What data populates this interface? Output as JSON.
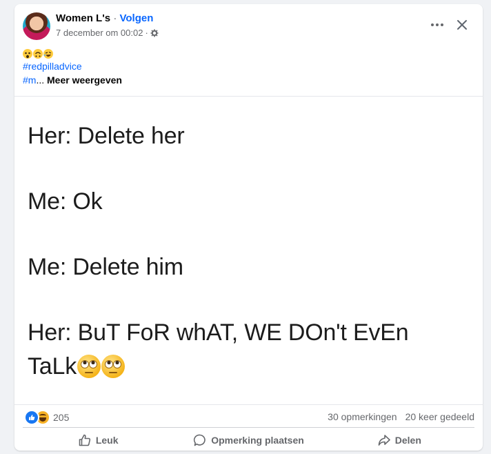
{
  "post": {
    "author": "Women L's",
    "separator": "·",
    "follow_label": "Volgen",
    "timestamp": "7 december om 00:02",
    "meta_separator": "·",
    "audience_icon": "gear-icon",
    "caption": {
      "emojis": [
        "astonished-emoji",
        "upside-down-emoji",
        "rofl-emoji"
      ],
      "hashtag_1": "#redpilladvice",
      "hashtag_2": "#m",
      "truncation": "...",
      "see_more": "Meer weergeven"
    },
    "image_text": {
      "line_1": "Her: Delete her",
      "line_2": "Me: Ok",
      "line_3": "Me: Delete him",
      "line_4": "Her: BuT FoR whAT, WE DOn't EvEn",
      "line_5": "TaLk"
    },
    "stats": {
      "reaction_count": "205",
      "comments": "30 opmerkingen",
      "shares": "20 keer gedeeld"
    },
    "actions": {
      "like": "Leuk",
      "comment": "Opmerking plaatsen",
      "share": "Delen"
    }
  },
  "colors": {
    "accent": "#0866ff",
    "secondary_text": "#65676b",
    "like_blue": "#1877f2",
    "haha_yellow": "#f7b125"
  }
}
